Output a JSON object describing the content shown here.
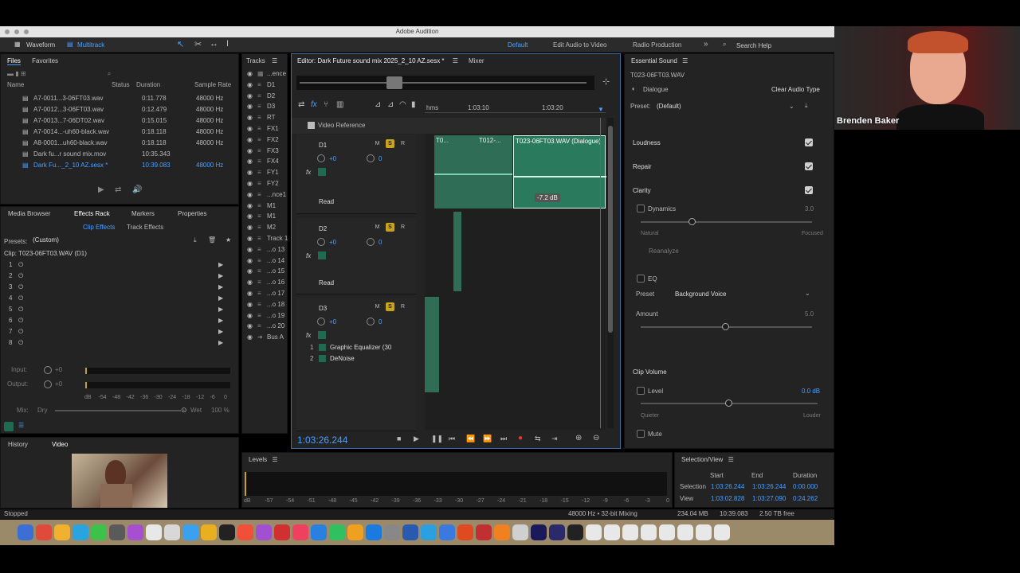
{
  "window": {
    "title": "Adobe Audition"
  },
  "toolbar": {
    "waveform": "Waveform",
    "multitrack": "Multitrack",
    "workspaces": [
      "Default",
      "Edit Audio to Video",
      "Radio Production"
    ],
    "search": "Search Help"
  },
  "files": {
    "tab": "Files",
    "tab2": "Favorites",
    "cols": [
      "Name",
      "Status",
      "Duration",
      "Sample Rate"
    ],
    "rows": [
      {
        "name": "A7-0011...3-06FT03.wav",
        "dur": "0:11.778",
        "rate": "48000 Hz"
      },
      {
        "name": "A7-0012...3-06FT03.wav",
        "dur": "0:12.479",
        "rate": "48000 Hz"
      },
      {
        "name": "A7-0013...7-06DT02.wav",
        "dur": "0:15.015",
        "rate": "48000 Hz"
      },
      {
        "name": "A7-0014...-uh60-black.wav",
        "dur": "0:18.118",
        "rate": "48000 Hz"
      },
      {
        "name": "A8-0001...uh60-black.wav",
        "dur": "0:18.118",
        "rate": "48000 Hz"
      },
      {
        "name": "Dark fu...r sound mix.mov",
        "dur": "10:35.343",
        "rate": ""
      },
      {
        "name": "Dark Fu..._2_10 AZ.sesx *",
        "dur": "10:39.083",
        "rate": "48000 Hz"
      }
    ]
  },
  "effects": {
    "tabs": [
      "Media Browser",
      "Effects Rack",
      "Markers",
      "Properties"
    ],
    "sub": [
      "Clip Effects",
      "Track Effects"
    ],
    "presets_label": "Presets:",
    "preset": "(Custom)",
    "clip": "Clip: T023-06FT03.WAV (D1)",
    "slots": [
      "1",
      "2",
      "3",
      "4",
      "5",
      "6",
      "7",
      "8"
    ],
    "input": "Input:",
    "output": "Output:",
    "io_val": "+0",
    "mix": "Mix:",
    "dry": "Dry",
    "wet": "Wet",
    "pct": "100 %",
    "scale": [
      "dB",
      "-54",
      "-48",
      "-42",
      "-36",
      "-30",
      "-24",
      "-18",
      "-12",
      "-6",
      "0"
    ]
  },
  "history": {
    "tabs": [
      "History",
      "Video"
    ]
  },
  "status": {
    "left": "Stopped",
    "items": [
      "48000 Hz • 32-bit Mixing",
      "234.04 MB",
      "10:39.083",
      "2.50 TB free"
    ]
  },
  "tracks": {
    "title": "Tracks",
    "items": [
      "...ence",
      "D1",
      "D2",
      "D3",
      "RT",
      "FX1",
      "FX2",
      "FX3",
      "FX4",
      "FY1",
      "FY2",
      "...nce1",
      "M1",
      "M1",
      "M2",
      "Track 1",
      "...o 13",
      "...o 14",
      "...o 15",
      "...o 16",
      "...o 17",
      "...o 18",
      "...o 19",
      "...o 20",
      "Bus A"
    ]
  },
  "editor": {
    "title": "Editor: Dark Future sound mix 2025_2_10 AZ.sesx *",
    "mixer": "Mixer",
    "ruler": [
      "hms",
      "1:03:10",
      "1:03:20"
    ],
    "video_ref": "Video Reference",
    "tracks": [
      {
        "name": "D1",
        "vol": "+0",
        "pan": "0",
        "mode": "Read",
        "fx": []
      },
      {
        "name": "D2",
        "vol": "+0",
        "pan": "0",
        "mode": "Read",
        "fx": []
      },
      {
        "name": "D3",
        "vol": "+0",
        "pan": "0",
        "mode": "",
        "fx": [
          "Graphic Equalizer (30",
          "DeNoise"
        ]
      }
    ],
    "clip": "T023-06FT03.WAV (Dialogue)",
    "clip_small": [
      "T0...",
      "T012-..."
    ],
    "gain": "-7.2 dB",
    "time": "1:03:26.244"
  },
  "essential": {
    "title": "Essential Sound",
    "file": "T023-06FT03.WAV",
    "type": "Dialogue",
    "clear": "Clear Audio Type",
    "preset_label": "Preset:",
    "preset": "(Default)",
    "sections": [
      "Loudness",
      "Repair",
      "Clarity"
    ],
    "dynamics": "Dynamics",
    "dyn_val": "3.0",
    "natural": "Natural",
    "focused": "Focused",
    "reanalyze": "Reanalyze",
    "eq": "EQ",
    "eq_preset_label": "Preset",
    "eq_preset": "Background Voice",
    "amount": "Amount",
    "amount_val": "5.0",
    "clip_volume": "Clip Volume",
    "level": "Level",
    "level_val": "0.0 dB",
    "quieter": "Quieter",
    "louder": "Louder",
    "mute": "Mute"
  },
  "levels": {
    "title": "Levels",
    "scale": [
      "dB",
      "-57",
      "-54",
      "-51",
      "-48",
      "-45",
      "-42",
      "-39",
      "-36",
      "-33",
      "-30",
      "-27",
      "-24",
      "-21",
      "-18",
      "-15",
      "-12",
      "-9",
      "-6",
      "-3",
      "0"
    ]
  },
  "selection": {
    "title": "Selection/View",
    "cols": [
      "Start",
      "End",
      "Duration"
    ],
    "rows": [
      {
        "label": "Selection",
        "start": "1:03:26.244",
        "end": "1:03:26.244",
        "dur": "0:00.000"
      },
      {
        "label": "View",
        "start": "1:03:02.828",
        "end": "1:03:27.090",
        "dur": "0:24.262"
      }
    ]
  },
  "webcam": {
    "name": "Brenden Baker"
  }
}
